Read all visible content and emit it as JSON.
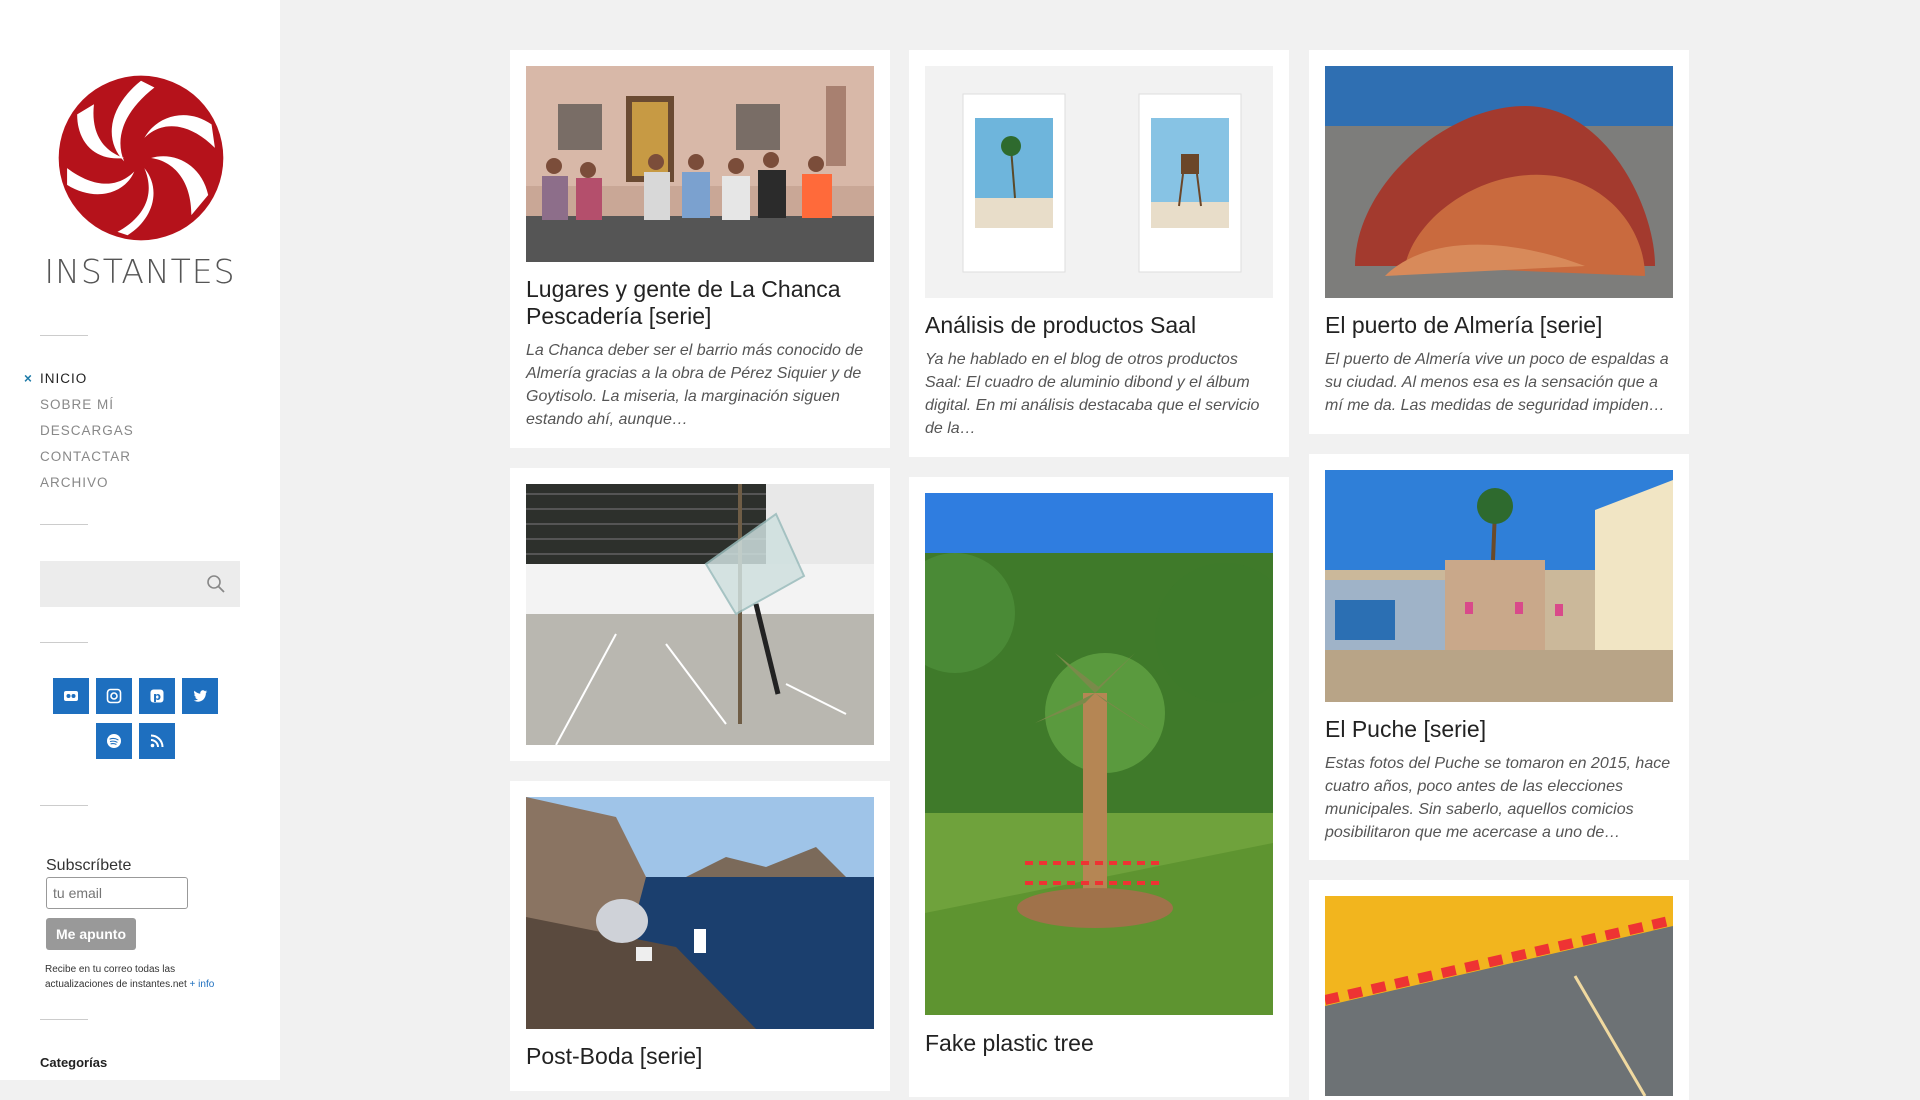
{
  "site": {
    "title": "INSTANTES",
    "logo_icon": "aperture-logo-icon",
    "accent": "#b5121b"
  },
  "nav": {
    "items": [
      "INICIO",
      "SOBRE MÍ",
      "DESCARGAS",
      "CONTACTAR",
      "ARCHIVO"
    ],
    "active": "INICIO"
  },
  "search": {
    "placeholder": ""
  },
  "social": [
    "flickr-icon",
    "instagram-icon",
    "pinterest-icon",
    "twitter-icon",
    "spotify-icon",
    "rss-icon"
  ],
  "subscribe": {
    "label": "Subscríbete",
    "placeholder": "tu email",
    "button": "Me apunto",
    "note": "Recibe en tu correo todas las actualizaciones de instantes.net",
    "note_link": "+ info"
  },
  "categories_title": "Categorías",
  "posts": [
    {
      "title": "Lugares y gente de La Chanca Pescadería [serie]",
      "excerpt": "La Chanca deber ser el barrio más conocido de Almería gracias a la obra de Pérez Siquier y de Goytisolo. La miseria, la marginación siguen estando ahí, aunque…"
    },
    {
      "title": "Análisis de productos Saal",
      "excerpt": "Ya he hablado en el blog de otros productos Saal: El cuadro de aluminio dibond y el álbum digital. En mi análisis destacaba que el servicio de la…"
    },
    {
      "title": "El puerto de Almería [serie]",
      "excerpt": "El puerto de Almería vive un poco de espaldas a su ciudad. Al menos esa es la sensación que a mí me da. Las medidas de seguridad impiden…"
    },
    {
      "title": "",
      "excerpt": ""
    },
    {
      "title": "Fake plastic tree",
      "excerpt": ""
    },
    {
      "title": "El Puche [serie]",
      "excerpt": "Estas fotos del Puche se tomaron en 2015, hace cuatro años, poco antes de las elecciones municipales. Sin saberlo, aquellos comicios posibilitaron que me acercase a uno de…"
    },
    {
      "title": "Post-Boda [serie]",
      "excerpt": ""
    },
    {
      "title": "",
      "excerpt": ""
    }
  ]
}
